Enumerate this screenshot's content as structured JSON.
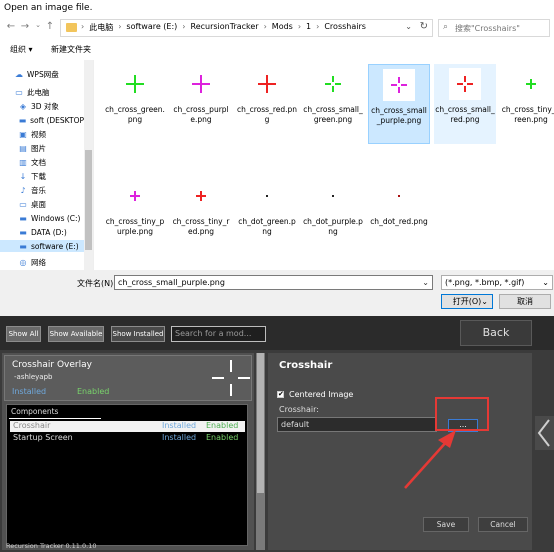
{
  "dialog": {
    "title": "Open an image file.",
    "breadcrumbs": [
      "此电脑",
      "software (E:)",
      "RecursionTracker",
      "Mods",
      "1",
      "Crosshairs"
    ],
    "search_placeholder": "搜索\"Crosshairs\"",
    "organize_label": "组织 ▾",
    "new_folder_label": "新建文件夹",
    "sidebar": [
      {
        "label": "WPS网盘",
        "icon": "cloud-icon"
      },
      {
        "label": "此电脑",
        "icon": "computer-icon"
      },
      {
        "label": "3D 对象",
        "icon": "cube-icon"
      },
      {
        "label": "soft (DESKTOP",
        "icon": "network-drive-icon"
      },
      {
        "label": "视频",
        "icon": "video-icon"
      },
      {
        "label": "图片",
        "icon": "picture-icon"
      },
      {
        "label": "文档",
        "icon": "document-icon"
      },
      {
        "label": "下载",
        "icon": "download-icon"
      },
      {
        "label": "音乐",
        "icon": "music-icon"
      },
      {
        "label": "桌面",
        "icon": "desktop-icon"
      },
      {
        "label": "Windows (C:)",
        "icon": "drive-icon"
      },
      {
        "label": "DATA (D:)",
        "icon": "drive-icon"
      },
      {
        "label": "software (E:)",
        "icon": "drive-icon"
      },
      {
        "label": "网络",
        "icon": "network-icon"
      }
    ],
    "files": [
      {
        "name": "ch_cross_green.png",
        "color": "#22dd22",
        "kind": "cross"
      },
      {
        "name": "ch_cross_purple.png",
        "color": "#dd22dd",
        "kind": "cross"
      },
      {
        "name": "ch_cross_red.png",
        "color": "#ee2222",
        "kind": "cross"
      },
      {
        "name": "ch_cross_small_green.png",
        "color": "#22dd22",
        "kind": "cross-small"
      },
      {
        "name": "ch_cross_small_purple.png",
        "color": "#dd22dd",
        "kind": "cross-small"
      },
      {
        "name": "ch_cross_small_red.png",
        "color": "#ee2222",
        "kind": "cross-small"
      },
      {
        "name": "ch_cross_tiny_green.png",
        "color": "#22dd22",
        "kind": "cross-tiny"
      },
      {
        "name": "ch_cross_tiny_purple.png",
        "color": "#dd22dd",
        "kind": "cross-tiny"
      },
      {
        "name": "ch_cross_tiny_red.png",
        "color": "#ee2222",
        "kind": "cross-tiny"
      },
      {
        "name": "ch_dot_green.png",
        "color": "#222222",
        "kind": "dot"
      },
      {
        "name": "ch_dot_purple.png",
        "color": "#222222",
        "kind": "dot"
      },
      {
        "name": "ch_dot_red.png",
        "color": "#aa1111",
        "kind": "dot"
      }
    ],
    "filename_label": "文件名(N):",
    "filename_value": "ch_cross_small_purple.png",
    "filetype_value": "(*.png, *.bmp, *.gif)",
    "open_label": "打开(O)",
    "cancel_label": "取消"
  },
  "game": {
    "tabs": [
      "Show All",
      "Show Available",
      "Show Installed"
    ],
    "search_placeholder": "Search for a mod...",
    "back_label": "Back",
    "mod": {
      "title": "Crosshair Overlay",
      "author": "-ashleyapb",
      "installed": "Installed",
      "enabled": "Enabled"
    },
    "components_header": "Components",
    "components": [
      {
        "name": "Crosshair",
        "installed": "Installed",
        "enabled": "Enabled"
      },
      {
        "name": "Startup Screen",
        "installed": "Installed",
        "enabled": "Enabled"
      }
    ],
    "panel_title": "Crosshair",
    "centered_label": "Centered Image",
    "crosshair_label": "Crosshair:",
    "crosshair_value": "default",
    "browse_label": "...",
    "save_label": "Save",
    "cancel_label": "Cancel",
    "version": "Recursion Tracker 0.11.0.10"
  },
  "colors": {
    "accent_blue": "#3a7bd5",
    "annotation_red": "#e53935",
    "installed_blue": "#6fa8dc",
    "enabled_green": "#79d36b"
  }
}
